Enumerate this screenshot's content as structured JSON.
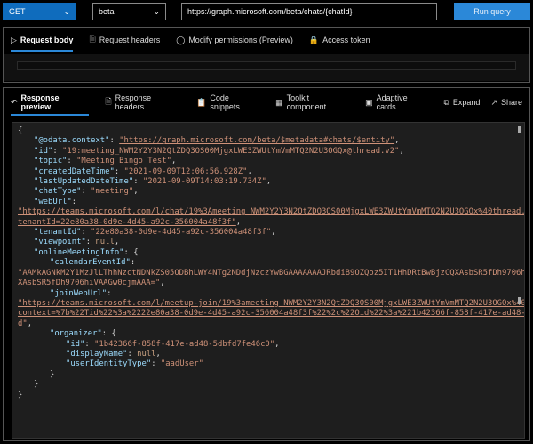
{
  "toolbar": {
    "method": "GET",
    "version": "beta",
    "url": "https://graph.microsoft.com/beta/chats/{chatId}",
    "run_label": "Run query"
  },
  "request": {
    "tabs": [
      {
        "label": "Request body",
        "icon": "send-icon"
      },
      {
        "label": "Request headers",
        "icon": "document-icon"
      },
      {
        "label": "Modify permissions (Preview)",
        "icon": "shield-icon"
      },
      {
        "label": "Access token",
        "icon": "lock-icon"
      }
    ]
  },
  "response": {
    "tabs": [
      {
        "label": "Response preview",
        "icon": "undo-icon"
      },
      {
        "label": "Response headers",
        "icon": "document-icon"
      },
      {
        "label": "Code snippets",
        "icon": "clipboard-code-icon"
      },
      {
        "label": "Toolkit component",
        "icon": "toolkit-icon"
      },
      {
        "label": "Adaptive cards",
        "icon": "card-icon"
      }
    ],
    "expand_label": "Expand",
    "share_label": "Share"
  },
  "colors": {
    "accent": "#2b88d8",
    "key": "#9cdcfe",
    "string": "#ce9178"
  },
  "code_lines": [
    [
      0,
      [
        [
          "p",
          "{"
        ]
      ]
    ],
    [
      1,
      [
        [
          "k",
          "\"@odata.context\""
        ],
        [
          "p",
          ": "
        ],
        [
          "u",
          "\"https://graph.microsoft.com/beta/$metadata#chats/$entity\""
        ],
        [
          "p",
          ","
        ]
      ]
    ],
    [
      1,
      [
        [
          "k",
          "\"id\""
        ],
        [
          "p",
          ": "
        ],
        [
          "s",
          "\"19:meeting_NWM2Y2Y3N2QtZDQ3OS00MjgxLWE3ZWUtYmVmMTQ2N2U3OGQx@thread.v2\""
        ],
        [
          "p",
          ","
        ]
      ]
    ],
    [
      1,
      [
        [
          "k",
          "\"topic\""
        ],
        [
          "p",
          ": "
        ],
        [
          "s",
          "\"Meeting Bingo Test\""
        ],
        [
          "p",
          ","
        ]
      ]
    ],
    [
      1,
      [
        [
          "k",
          "\"createdDateTime\""
        ],
        [
          "p",
          ": "
        ],
        [
          "s",
          "\"2021-09-09T12:06:56.928Z\""
        ],
        [
          "p",
          ","
        ]
      ]
    ],
    [
      1,
      [
        [
          "k",
          "\"lastUpdatedDateTime\""
        ],
        [
          "p",
          ": "
        ],
        [
          "s",
          "\"2021-09-09T14:03:19.734Z\""
        ],
        [
          "p",
          ","
        ]
      ]
    ],
    [
      1,
      [
        [
          "k",
          "\"chatType\""
        ],
        [
          "p",
          ": "
        ],
        [
          "s",
          "\"meeting\""
        ],
        [
          "p",
          ","
        ]
      ]
    ],
    [
      1,
      [
        [
          "k",
          "\"webUrl\""
        ],
        [
          "p",
          ":"
        ]
      ]
    ],
    [
      0,
      [
        [
          "u",
          "\"https://teams.microsoft.com/l/chat/19%3Ameeting_NWM2Y2Y3N2QtZDQ3OS00MjgxLWE3ZWUtYmVmMTQ2N2U3OGQx%40thread.v2/0?"
        ]
      ]
    ],
    [
      0,
      [
        [
          "u",
          "tenantId=22e80a38-0d9e-4d45-a92c-356004a48f3f\""
        ],
        [
          "p",
          ","
        ]
      ]
    ],
    [
      1,
      [
        [
          "k",
          "\"tenantId\""
        ],
        [
          "p",
          ": "
        ],
        [
          "s",
          "\"22e80a38-0d9e-4d45-a92c-356004a48f3f\""
        ],
        [
          "p",
          ","
        ]
      ]
    ],
    [
      1,
      [
        [
          "k",
          "\"viewpoint\""
        ],
        [
          "p",
          ": "
        ],
        [
          "n",
          "null"
        ],
        [
          "p",
          ","
        ]
      ]
    ],
    [
      1,
      [
        [
          "k",
          "\"onlineMeetingInfo\""
        ],
        [
          "p",
          ": {"
        ]
      ]
    ],
    [
      2,
      [
        [
          "k",
          "\"calendarEventId\""
        ],
        [
          "p",
          ":"
        ]
      ]
    ],
    [
      0,
      [
        [
          "s",
          "\"AAMkAGNkM2Y1MzJlLThhNzctNDNkZS05ODBhLWY4NTg2NDdjNzczYwBGAAAAAAAJRbdiB9OZQoz5IT1HhDRtBwBjzCQXAsbSR5fDh9706hiVAAAAAAENAABjzCQ"
        ]
      ]
    ],
    [
      0,
      [
        [
          "s",
          "XAsbSR5fDh9706hiVAAGw0cjmAAA=\""
        ],
        [
          "p",
          ","
        ]
      ]
    ],
    [
      2,
      [
        [
          "k",
          "\"joinWebUrl\""
        ],
        [
          "p",
          ":"
        ]
      ]
    ],
    [
      0,
      [
        [
          "u",
          "\"https://teams.microsoft.com/l/meetup-join/19%3ameeting_NWM2Y2Y3N2QtZDQ3OS00MjgxLWE3ZWUtYmVmMTQ2N2U3OGQx%40thread.v2/0?"
        ]
      ]
    ],
    [
      0,
      [
        [
          "u",
          "context=%7b%22Tid%22%3a%2222e80a38-0d9e-4d45-a92c-356004a48f3f%22%2c%22Oid%22%3a%221b42366f-858f-417e-ad48-5dbfd7fe46c0%22%7"
        ]
      ]
    ],
    [
      0,
      [
        [
          "u",
          "d\""
        ],
        [
          "p",
          ","
        ]
      ]
    ],
    [
      2,
      [
        [
          "k",
          "\"organizer\""
        ],
        [
          "p",
          ": {"
        ]
      ]
    ],
    [
      3,
      [
        [
          "k",
          "\"id\""
        ],
        [
          "p",
          ": "
        ],
        [
          "s",
          "\"1b42366f-858f-417e-ad48-5dbfd7fe46c0\""
        ],
        [
          "p",
          ","
        ]
      ]
    ],
    [
      3,
      [
        [
          "k",
          "\"displayName\""
        ],
        [
          "p",
          ": "
        ],
        [
          "n",
          "null"
        ],
        [
          "p",
          ","
        ]
      ]
    ],
    [
      3,
      [
        [
          "k",
          "\"userIdentityType\""
        ],
        [
          "p",
          ": "
        ],
        [
          "s",
          "\"aadUser\""
        ]
      ]
    ],
    [
      2,
      [
        [
          "p",
          "}"
        ]
      ]
    ],
    [
      1,
      [
        [
          "p",
          "}"
        ]
      ]
    ],
    [
      0,
      [
        [
          "p",
          "}"
        ]
      ]
    ]
  ]
}
